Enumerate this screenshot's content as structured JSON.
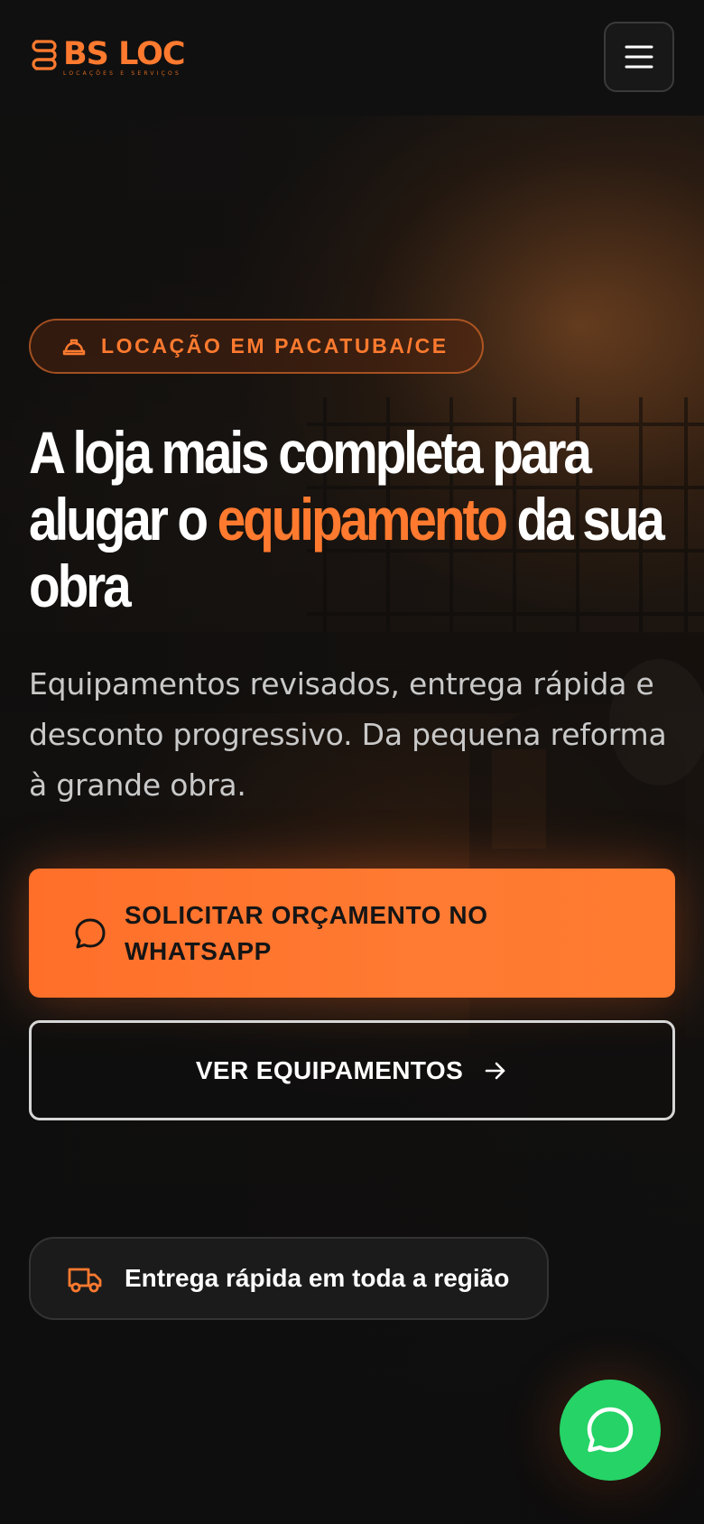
{
  "header": {
    "brand_name": "BS LOC",
    "brand_tagline": "LOCAÇÕES E SERVIÇOS",
    "menu_icon": "hamburger-menu-icon"
  },
  "hero": {
    "badge": {
      "icon": "hard-hat-icon",
      "label": "LOCAÇÃO EM PACATUBA/CE"
    },
    "headline": {
      "part1": "A loja mais completa para alugar o ",
      "accent": "equipamento",
      "part2": " da sua obra"
    },
    "subtitle": "Equipamentos revisados, entrega rápida e desconto progressivo. Da pequena reforma à grande obra.",
    "cta_primary": {
      "icon": "chat-bubble-icon",
      "label": "SOLICITAR ORÇAMENTO NO WHATSAPP"
    },
    "cta_secondary": {
      "label": "VER EQUIPAMENTOS",
      "icon": "arrow-right-icon"
    },
    "feature": {
      "icon": "truck-icon",
      "label": "Entrega rápida em toda a região"
    }
  },
  "floating_whatsapp": {
    "icon": "whatsapp-icon"
  },
  "colors": {
    "accent": "#ff7a2f",
    "background": "#0e0e0e",
    "whatsapp": "#25d366"
  }
}
